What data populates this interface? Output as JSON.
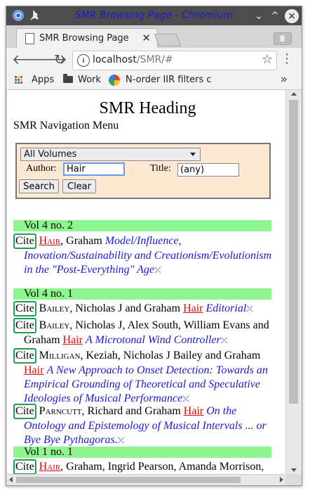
{
  "browser": {
    "window_title": "SMR Browsing Page - Chromium",
    "tab_title": "SMR Browsing Page",
    "url_host": "localhost",
    "url_path": "/SMR/#",
    "bookmarks": {
      "apps": "Apps",
      "work": "Work",
      "nfilters": "N-order IIR filters c"
    }
  },
  "page": {
    "heading": "SMR Heading",
    "nav_menu": "SMR Navigation Menu",
    "search": {
      "volume_selected": "All Volumes",
      "author_label": "Author:",
      "author_value": "Hair",
      "title_label": "Title:",
      "title_value": "(any)",
      "search_button": "Search",
      "clear_button": "Clear"
    },
    "vol1": "Vol 4 no. 2",
    "vol2": "Vol 4 no. 1",
    "vol3": "Vol 1 no. 1",
    "cite_label": "Cite",
    "hair": "Hair",
    "close_mark": "⤫",
    "e1": {
      "rest": ", Graham ",
      "title": "Model/Influence, Inovation/Sustainability and Creationism/Evolutionism in the \"Post-Everything\" Age"
    },
    "e2": {
      "first": "Bailey",
      "mid": ", Nicholas J and Graham ",
      "title": "Editorial"
    },
    "e3": {
      "first": "Bailey",
      "mid": ", Nicholas J, Alex South, William Evans and Graham ",
      "title": "A Microtonal Wind Controller"
    },
    "e4": {
      "first": "Milligan",
      "mid": ", Keziah, Nicholas J Bailey and Graham ",
      "title": "A New Approach to Onset Detection: Towards an Empirical Grounding of Theoretical and Speculative Ideologies of Musical Performance"
    },
    "e5": {
      "first": "Parncutt",
      "mid": ", Richard and Graham ",
      "title": "On the Ontology and Epistemology of Musical Intervals ... or Bye Bye Pythagoras."
    },
    "e6": {
      "rest": ", Graham, Ingrid Pearson, Amanda Morrison,"
    }
  }
}
